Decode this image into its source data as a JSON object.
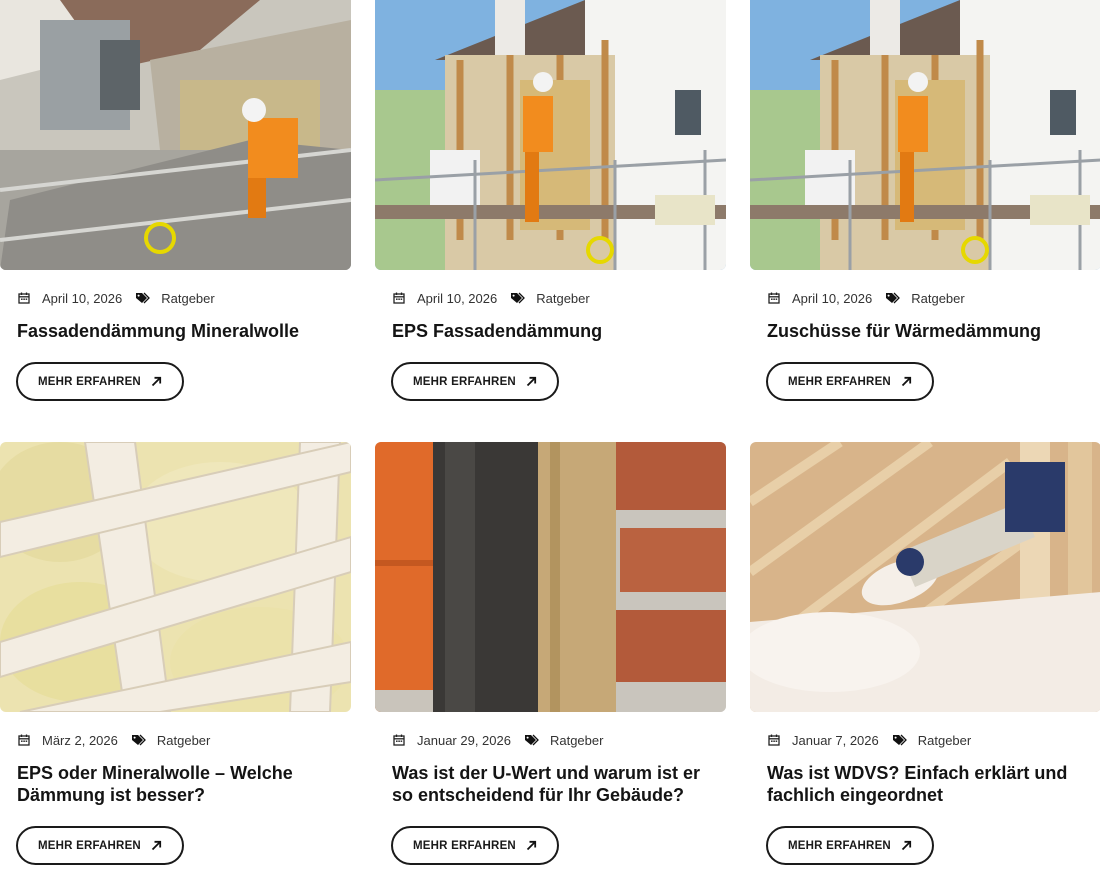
{
  "cards": [
    {
      "date": "April 10, 2026",
      "category": "Ratgeber",
      "title": "Fassadendämmung Mineralwolle",
      "button": "MEHR ERFAHREN"
    },
    {
      "date": "April 10, 2026",
      "category": "Ratgeber",
      "title": "EPS Fassadendämmung",
      "button": "MEHR ERFAHREN"
    },
    {
      "date": "April 10, 2026",
      "category": "Ratgeber",
      "title": "Zuschüsse für Wärmedämmung",
      "button": "MEHR ERFAHREN"
    },
    {
      "date": "März 2, 2026",
      "category": "Ratgeber",
      "title": "EPS oder Mineralwolle – Welche Dämmung ist besser?",
      "button": "MEHR ERFAHREN"
    },
    {
      "date": "Januar 29, 2026",
      "category": "Ratgeber",
      "title": "Was ist der U-Wert und warum ist er so entscheidend für Ihr Gebäude?",
      "button": "MEHR ERFAHREN"
    },
    {
      "date": "Januar 7, 2026",
      "category": "Ratgeber",
      "title": "Was ist WDVS? Einfach erklärt und fachlich eingeordnet",
      "button": "MEHR ERFAHREN"
    }
  ],
  "icons": {
    "date": "calendar-icon",
    "category": "tag-icon",
    "button": "arrow-up-right-icon"
  },
  "colors": {
    "text": "#1a1a1a",
    "background": "#ffffff",
    "worker_orange": "#f28c1e"
  }
}
